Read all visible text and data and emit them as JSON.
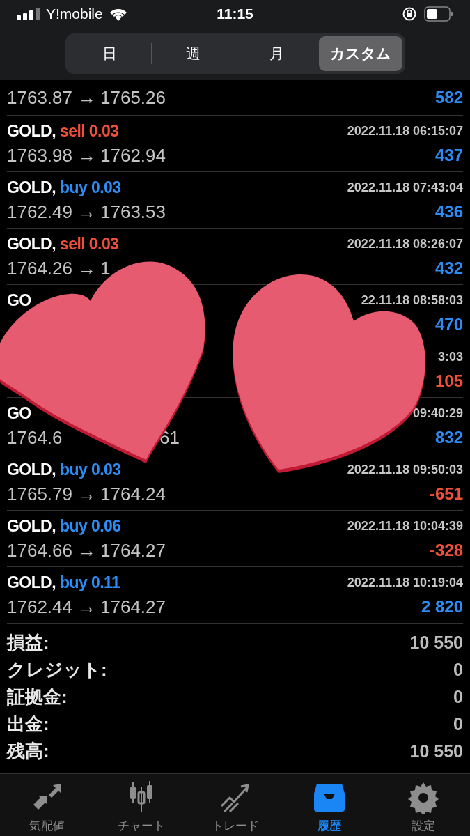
{
  "status_bar": {
    "carrier": "Y!mobile",
    "time": "11:15"
  },
  "period_tabs": [
    {
      "label": "日",
      "selected": false
    },
    {
      "label": "週",
      "selected": false
    },
    {
      "label": "月",
      "selected": false
    },
    {
      "label": "カスタム",
      "selected": true
    }
  ],
  "trades": [
    {
      "from": "1763.87",
      "arrow": "→",
      "to": "1765.26",
      "profit": "582",
      "loss": false
    },
    {
      "symbol": "GOLD,",
      "side": "sell",
      "volume": "0.03",
      "time": "2022.11.18 06:15:07",
      "from": "1763.98",
      "arrow": "→",
      "to": "1762.94",
      "profit": "437",
      "loss": false
    },
    {
      "symbol": "GOLD,",
      "side": "buy",
      "volume": "0.03",
      "time": "2022.11.18 07:43:04",
      "from": "1762.49",
      "arrow": "→",
      "to": "1763.53",
      "profit": "436",
      "loss": false
    },
    {
      "symbol": "GOLD,",
      "side": "sell",
      "volume": "0.03",
      "time": "2022.11.18 08:26:07",
      "from": "1764.26",
      "arrow": "→",
      "to": "1",
      "profit": "432",
      "loss": false
    },
    {
      "symbol": "GO",
      "time": "22.11.18 08:58:03",
      "profit": "470",
      "loss": false
    },
    {
      "time": "3:03",
      "profit": "105",
      "loss": true
    },
    {
      "symbol": "GO",
      "time": "09:40:29",
      "from": "1764.6",
      "to": "61",
      "profit": "832",
      "loss": false
    },
    {
      "symbol": "GOLD,",
      "side": "buy",
      "volume": "0.03",
      "time": "2022.11.18 09:50:03",
      "from": "1765.79",
      "arrow": "→",
      "to": "1764.24",
      "profit": "-651",
      "loss": true
    },
    {
      "symbol": "GOLD,",
      "side": "buy",
      "volume": "0.06",
      "time": "2022.11.18 10:04:39",
      "from": "1764.66",
      "arrow": "→",
      "to": "1764.27",
      "profit": "-328",
      "loss": true
    },
    {
      "symbol": "GOLD,",
      "side": "buy",
      "volume": "0.11",
      "time": "2022.11.18 10:19:04",
      "from": "1762.44",
      "arrow": "→",
      "to": "1764.27",
      "profit": "2 820",
      "loss": false
    }
  ],
  "summary": [
    {
      "label": "損益:",
      "value": "10 550"
    },
    {
      "label": "クレジット:",
      "value": "0"
    },
    {
      "label": "証拠金:",
      "value": "0"
    },
    {
      "label": "出金:",
      "value": "0"
    },
    {
      "label": "残高:",
      "value": "10 550"
    }
  ],
  "tab_bar": [
    {
      "kind": "quotes",
      "label": "気配値",
      "selected": false
    },
    {
      "kind": "chart",
      "label": "チャート",
      "selected": false
    },
    {
      "kind": "trade",
      "label": "トレード",
      "selected": false
    },
    {
      "kind": "history",
      "label": "履歴",
      "selected": true
    },
    {
      "kind": "settings",
      "label": "設定",
      "selected": false
    }
  ],
  "stickers": [
    {
      "kind": "heart"
    },
    {
      "kind": "heart"
    }
  ]
}
